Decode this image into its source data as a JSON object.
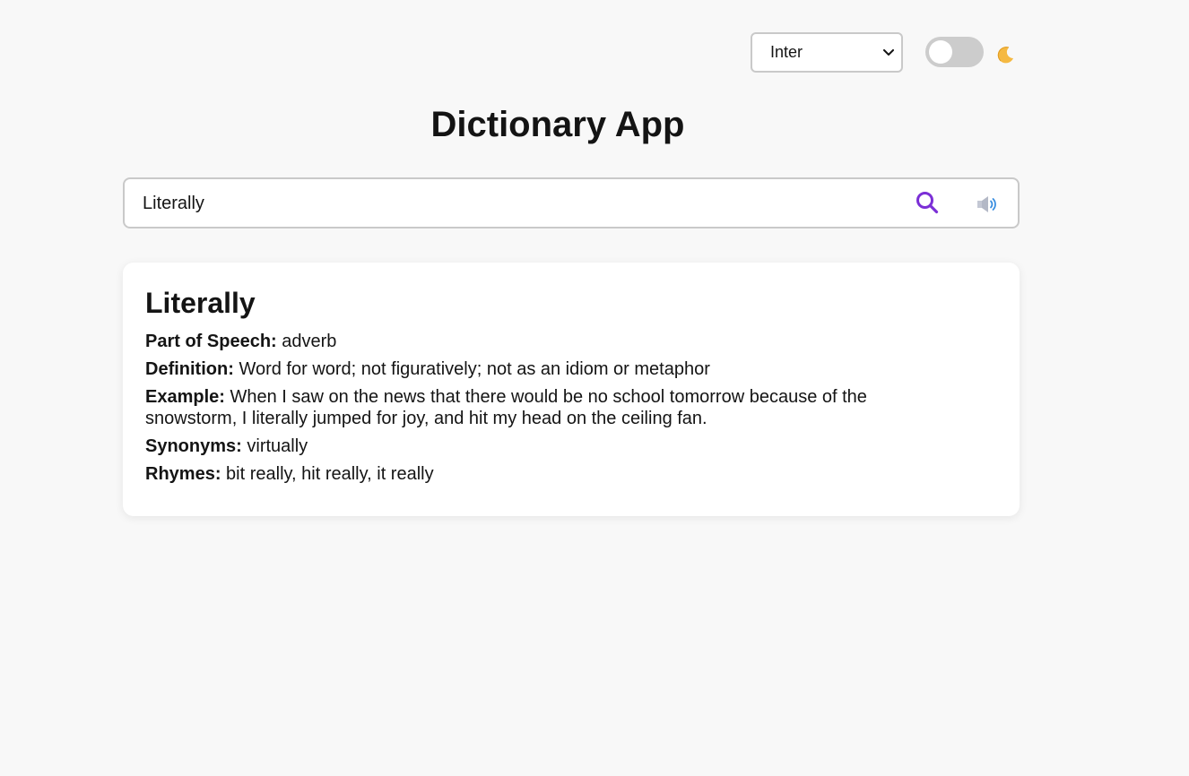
{
  "font_select": {
    "value": "Inter"
  },
  "app": {
    "title": "Dictionary App"
  },
  "search": {
    "value": "Literally"
  },
  "result": {
    "word": "Literally",
    "part_of_speech_label": "Part of Speech:",
    "part_of_speech": "adverb",
    "definition_label": "Definition:",
    "definition": "Word for word; not figuratively; not as an idiom or metaphor",
    "example_label": "Example:",
    "example": "When I saw on the news that there would be no school tomorrow because of the snowstorm, I literally jumped for joy, and hit my head on the ceiling fan.",
    "synonyms_label": "Synonyms:",
    "synonyms": "virtually",
    "rhymes_label": "Rhymes:",
    "rhymes": "bit really, hit really, it really"
  },
  "colors": {
    "accent": "#7b2fd6",
    "background": "#f8f8f8",
    "toggle_track": "#cccccc"
  }
}
